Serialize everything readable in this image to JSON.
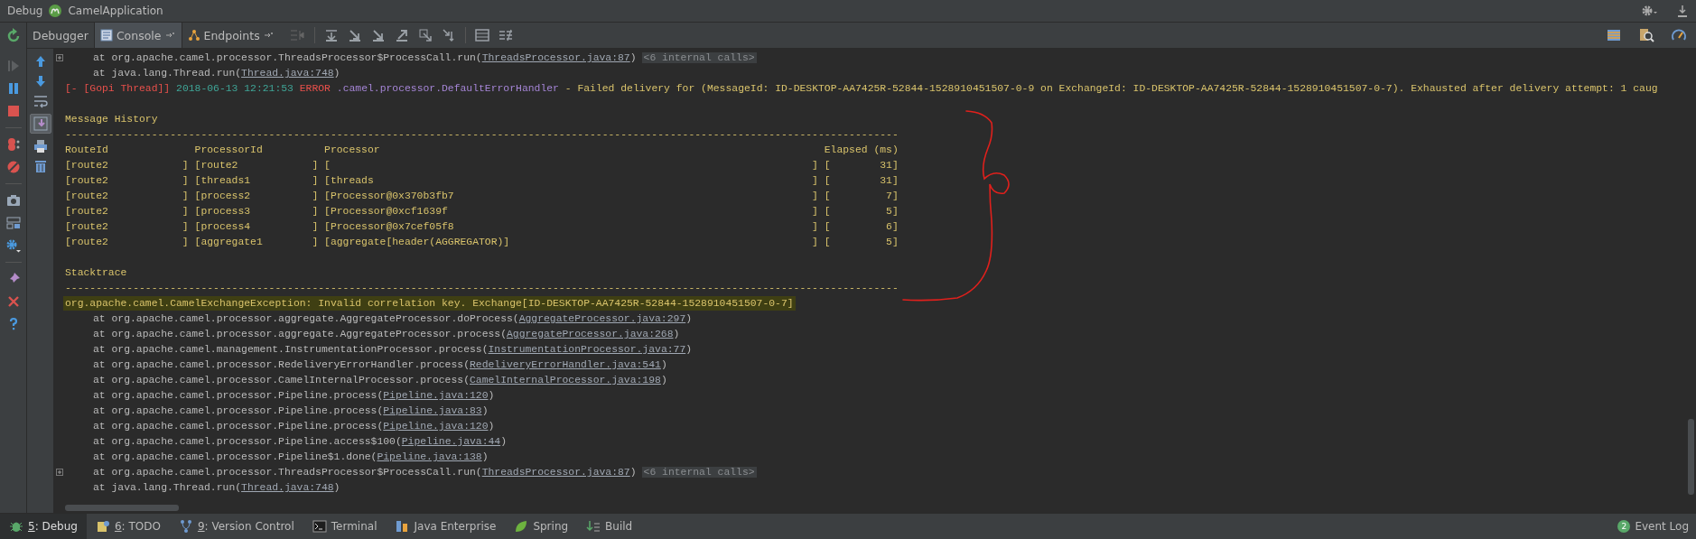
{
  "title_bar": {
    "label": "Debug",
    "app": "CamelApplication"
  },
  "tabs": [
    {
      "label": "Debugger",
      "selected": false,
      "kind": "plain"
    },
    {
      "label": "Console",
      "selected": true,
      "kind": "console"
    },
    {
      "label": "Endpoints",
      "selected": false,
      "kind": "endpoints"
    }
  ],
  "scroll_to_end": {
    "on": true
  },
  "console": {
    "lines": [
      {
        "kind": "frame",
        "expandable": true,
        "text": "at org.apache.camel.processor.ThreadsProcessor$ProcessCall.run(",
        "link": "ThreadsProcessor.java:87",
        "tail": ")",
        "folded": "<6 internal calls>"
      },
      {
        "kind": "frame",
        "expandable": false,
        "text": "at java.lang.Thread.run(",
        "link": "Thread.java:748",
        "tail": ")"
      },
      {
        "kind": "log",
        "thread": "[- [Gopi Thread]]",
        "time": "2018-06-13 12:21:53",
        "level": "ERROR",
        "logger": ".camel.processor.DefaultErrorHandler",
        "message": "- Failed delivery for (MessageId: ID-DESKTOP-AA7425R-52844-1528910451507-0-9 on ExchangeId: ID-DESKTOP-AA7425R-52844-1528910451507-0-7). Exhausted after delivery attempt: 1 caug"
      },
      {
        "kind": "blank"
      },
      {
        "kind": "text",
        "highlighted": false,
        "text": "Message History"
      },
      {
        "kind": "text",
        "highlighted": false,
        "text": "---------------------------------------------------------------------------------------------------------------------------------------"
      },
      {
        "kind": "text",
        "highlighted": false,
        "text": "RouteId              ProcessorId          Processor                                                                        Elapsed (ms)"
      },
      {
        "kind": "text",
        "highlighted": false,
        "text": "[route2            ] [route2            ] [                                                                              ] [        31]"
      },
      {
        "kind": "text",
        "highlighted": false,
        "text": "[route2            ] [threads1          ] [threads                                                                       ] [        31]"
      },
      {
        "kind": "text",
        "highlighted": false,
        "text": "[route2            ] [process2          ] [Processor@0x370b3fb7                                                          ] [         7]"
      },
      {
        "kind": "text",
        "highlighted": false,
        "text": "[route2            ] [process3          ] [Processor@0xcf1639f                                                           ] [         5]"
      },
      {
        "kind": "text",
        "highlighted": false,
        "text": "[route2            ] [process4          ] [Processor@0x7cef05f8                                                          ] [         6]"
      },
      {
        "kind": "text",
        "highlighted": false,
        "text": "[route2            ] [aggregate1        ] [aggregate[header(AGGREGATOR)]                                                 ] [         5]"
      },
      {
        "kind": "blank"
      },
      {
        "kind": "text",
        "highlighted": false,
        "text": "Stacktrace"
      },
      {
        "kind": "text",
        "highlighted": false,
        "text": "---------------------------------------------------------------------------------------------------------------------------------------"
      },
      {
        "kind": "text",
        "highlighted": true,
        "text": "org.apache.camel.CamelExchangeException: Invalid correlation key. Exchange[ID-DESKTOP-AA7425R-52844-1528910451507-0-7]"
      },
      {
        "kind": "frame",
        "expandable": false,
        "text": "at org.apache.camel.processor.aggregate.AggregateProcessor.doProcess(",
        "link": "AggregateProcessor.java:297",
        "tail": ")"
      },
      {
        "kind": "frame",
        "expandable": false,
        "text": "at org.apache.camel.processor.aggregate.AggregateProcessor.process(",
        "link": "AggregateProcessor.java:268",
        "tail": ")"
      },
      {
        "kind": "frame",
        "expandable": false,
        "text": "at org.apache.camel.management.InstrumentationProcessor.process(",
        "link": "InstrumentationProcessor.java:77",
        "tail": ")"
      },
      {
        "kind": "frame",
        "expandable": false,
        "text": "at org.apache.camel.processor.RedeliveryErrorHandler.process(",
        "link": "RedeliveryErrorHandler.java:541",
        "tail": ")"
      },
      {
        "kind": "frame",
        "expandable": false,
        "text": "at org.apache.camel.processor.CamelInternalProcessor.process(",
        "link": "CamelInternalProcessor.java:198",
        "tail": ")"
      },
      {
        "kind": "frame",
        "expandable": false,
        "text": "at org.apache.camel.processor.Pipeline.process(",
        "link": "Pipeline.java:120",
        "tail": ")"
      },
      {
        "kind": "frame",
        "expandable": false,
        "text": "at org.apache.camel.processor.Pipeline.process(",
        "link": "Pipeline.java:83",
        "tail": ")"
      },
      {
        "kind": "frame",
        "expandable": false,
        "text": "at org.apache.camel.processor.Pipeline.process(",
        "link": "Pipeline.java:120",
        "tail": ")"
      },
      {
        "kind": "frame",
        "expandable": false,
        "text": "at org.apache.camel.processor.Pipeline.access$100(",
        "link": "Pipeline.java:44",
        "tail": ")"
      },
      {
        "kind": "frame",
        "expandable": false,
        "text": "at org.apache.camel.processor.Pipeline$1.done(",
        "link": "Pipeline.java:138",
        "tail": ")"
      },
      {
        "kind": "frame",
        "expandable": true,
        "text": "at org.apache.camel.processor.ThreadsProcessor$ProcessCall.run(",
        "link": "ThreadsProcessor.java:87",
        "tail": ")",
        "folded": "<6 internal calls>"
      },
      {
        "kind": "frame",
        "expandable": false,
        "text": "at java.lang.Thread.run(",
        "link": "Thread.java:748",
        "tail": ")"
      }
    ]
  },
  "tool_windows": [
    {
      "key": "5",
      "label": ": Debug",
      "selected": true,
      "kind": "debug"
    },
    {
      "key": "6",
      "label": ": TODO",
      "selected": false,
      "kind": "todo"
    },
    {
      "key": "9",
      "label": ": Version Control",
      "selected": false,
      "kind": "vcs"
    },
    {
      "label": "Terminal",
      "selected": false,
      "kind": "terminal"
    },
    {
      "label": "Java Enterprise",
      "selected": false,
      "kind": "javaee"
    },
    {
      "label": "Spring",
      "selected": false,
      "kind": "spring"
    },
    {
      "label": "Build",
      "selected": false,
      "kind": "build"
    }
  ],
  "event_log": {
    "label": "Event Log",
    "count": "2"
  }
}
